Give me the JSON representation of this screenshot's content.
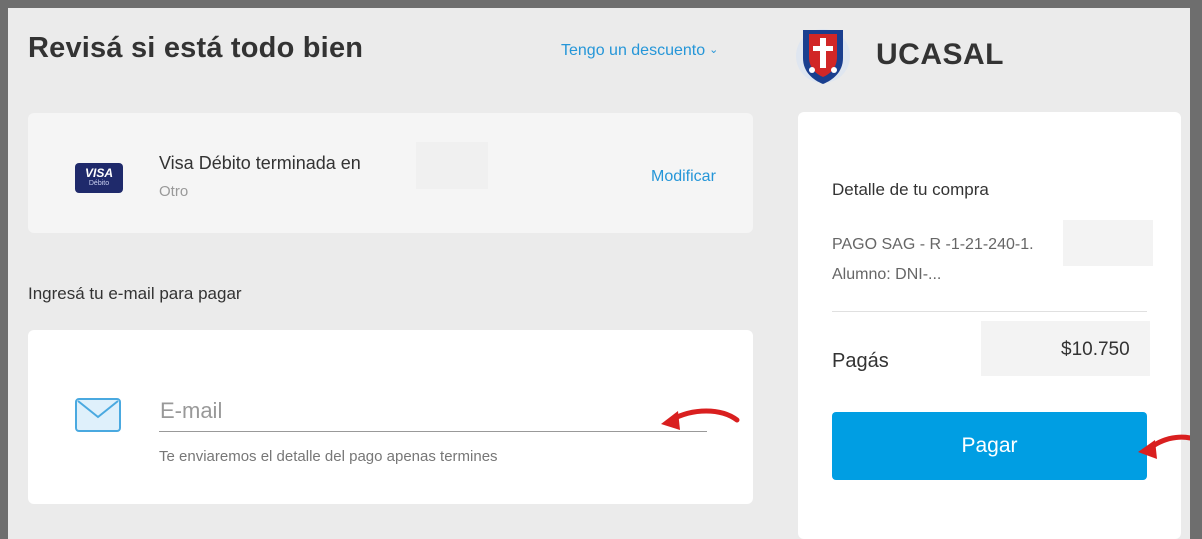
{
  "header": {
    "title": "Revisá si está todo bien",
    "discount_link": "Tengo un descuento",
    "discount_chevron": "⌄",
    "brand_name": "UCASAL",
    "logo_icon": "ucasal-shield-logo"
  },
  "payment_method": {
    "card_brand": "VISA",
    "card_type_badge": "Débito",
    "name": "Visa Débito terminada en",
    "issuer": "Otro",
    "modify_label": "Modificar"
  },
  "email_section": {
    "heading": "Ingresá tu e-mail para pagar",
    "placeholder": "E-mail",
    "helper": "Te enviaremos el detalle del pago apenas termines",
    "icon": "envelope-icon"
  },
  "summary": {
    "title": "Detalle de tu compra",
    "description": "PAGO SAG - R -1-21-240-1. Alumno: DNI-...",
    "pay_label": "Pagás",
    "amount": "$10.750",
    "pay_button": "Pagar"
  },
  "colors": {
    "accent": "#009ee3",
    "link": "#2596d8",
    "background": "#ebebeb",
    "annotation_arrow": "#d91f1f"
  }
}
